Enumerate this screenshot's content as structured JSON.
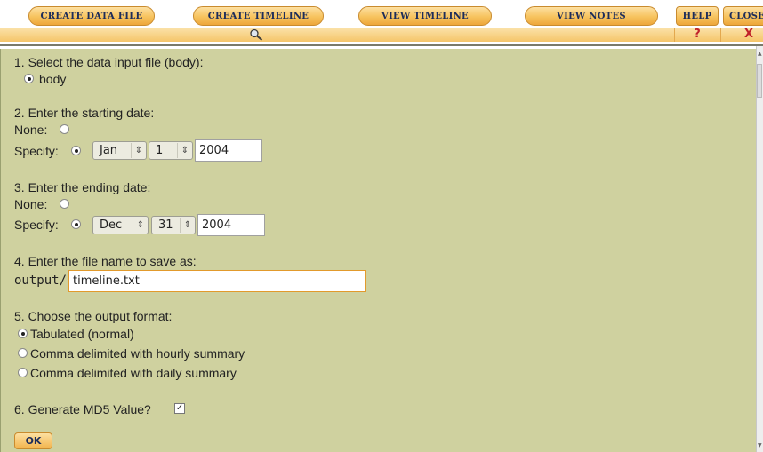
{
  "toolbar": {
    "tabs": [
      {
        "label": "Create Data File"
      },
      {
        "label": "Create Timeline"
      },
      {
        "label": "View Timeline"
      },
      {
        "label": "View Notes"
      },
      {
        "label": "Help"
      },
      {
        "label": "Close"
      }
    ],
    "help_glyph": "?",
    "close_glyph": "X",
    "accent_color": "#f7c35e",
    "text_color": "#1c2c5a",
    "glyph_color": "#c0202a"
  },
  "form": {
    "background_color": "#cfd19f",
    "step1": {
      "label": "1. Select the data input file (body):",
      "option": "body",
      "selected": true
    },
    "step2": {
      "label": "2. Enter the starting date:",
      "none_label": "None:",
      "specify_label": "Specify:",
      "selected": "specify",
      "month": "Jan",
      "day": "1",
      "year": "2004"
    },
    "step3": {
      "label": "3. Enter the ending date:",
      "none_label": "None:",
      "specify_label": "Specify:",
      "selected": "specify",
      "month": "Dec",
      "day": "31",
      "year": "2004"
    },
    "step4": {
      "label": "4. Enter the file name to save as:",
      "prefix": "output/",
      "value": "timeline.txt"
    },
    "step5": {
      "label": "5. Choose the output format:",
      "options": [
        {
          "label": "Tabulated (normal)",
          "selected": true
        },
        {
          "label": "Comma delimited with hourly summary",
          "selected": false
        },
        {
          "label": "Comma delimited with daily summary",
          "selected": false
        }
      ]
    },
    "step6": {
      "label": "6. Generate MD5 Value?",
      "checked": true,
      "check_glyph": "✓"
    },
    "ok_label": "OK"
  }
}
